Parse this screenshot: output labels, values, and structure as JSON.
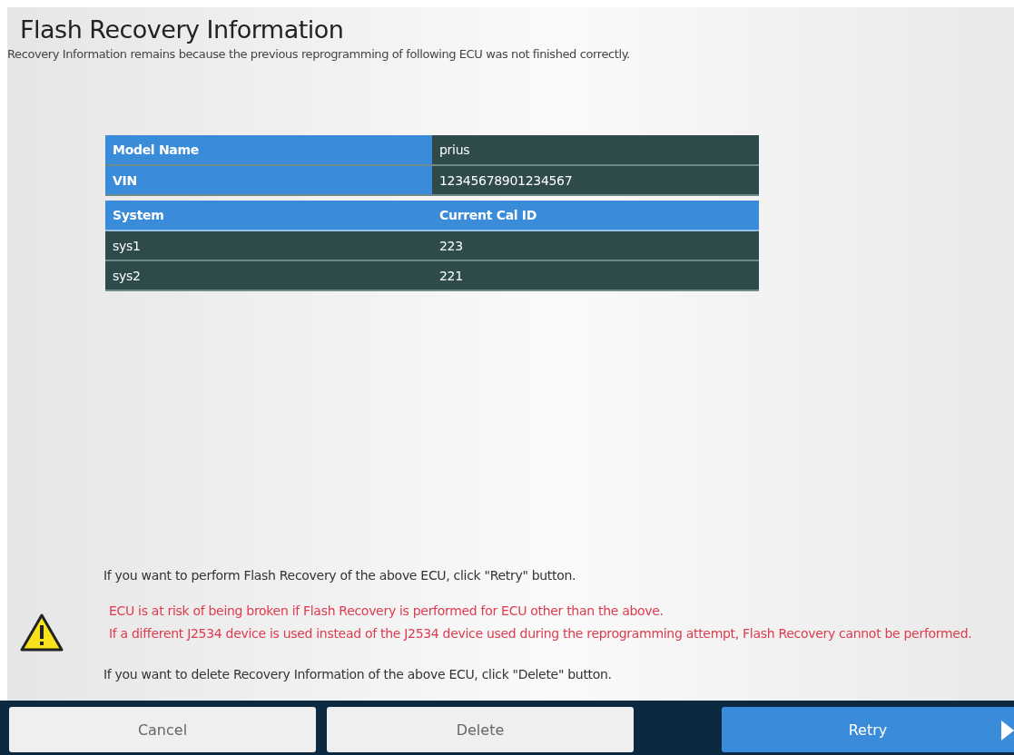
{
  "title": "Flash Recovery Information",
  "subtitle": "Recovery Information remains because the previous reprogramming of following ECU was not finished correctly.",
  "vehicle_table": [
    {
      "label": "Model Name",
      "value": "prius"
    },
    {
      "label": "VIN",
      "value": "12345678901234567"
    }
  ],
  "system_table": {
    "columns": [
      "System",
      "Current Cal ID"
    ],
    "rows": [
      [
        "sys1",
        "223"
      ],
      [
        "sys2",
        "221"
      ]
    ]
  },
  "messages": [
    {
      "kind": "info",
      "text": "If you want to perform Flash Recovery of the above ECU, click \"Retry\" button."
    },
    {
      "kind": "warning",
      "lines": [
        "ECU is at risk of being broken if Flash Recovery is performed for ECU other than the above.",
        "If a different J2534 device is used instead of the J2534 device used during the reprogramming attempt, Flash Recovery cannot be performed."
      ]
    },
    {
      "kind": "info",
      "text": "If you want to delete Recovery Information of the above ECU, click \"Delete\" button."
    }
  ],
  "buttons": [
    {
      "label": "Cancel",
      "kind": "secondary"
    },
    {
      "label": "Delete",
      "kind": "secondary"
    },
    {
      "label": "Retry",
      "kind": "primary"
    }
  ]
}
